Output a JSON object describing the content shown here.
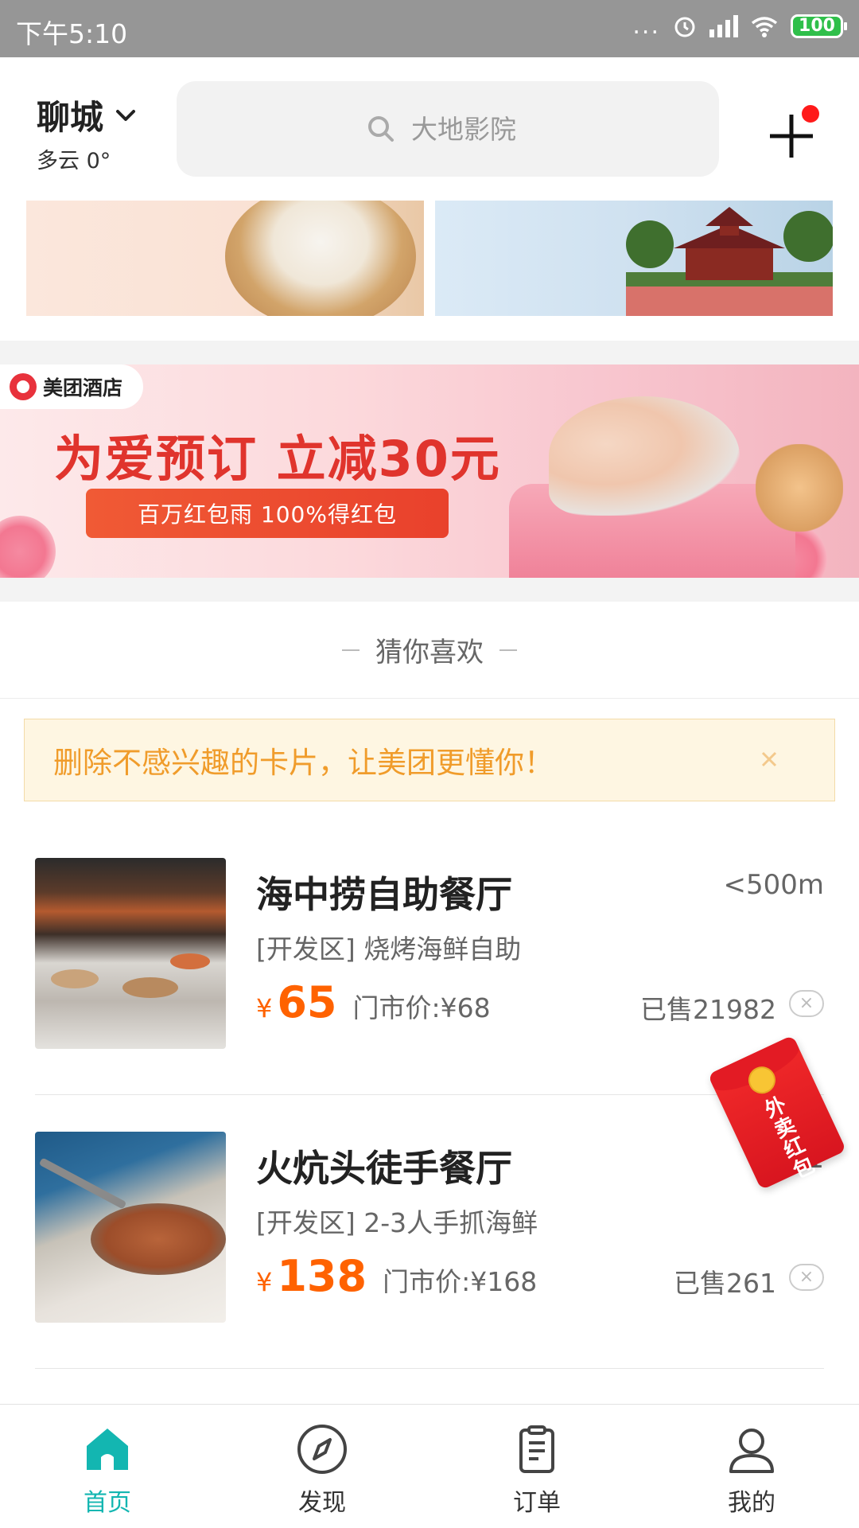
{
  "status_bar": {
    "time": "下午5:10",
    "dots": "...",
    "battery": "100"
  },
  "header": {
    "city": "聊城",
    "weather": "多云 0°",
    "search_placeholder": "大地影院"
  },
  "hotel_banner": {
    "brand": "美团酒店",
    "title": "为爱预订 立减30元",
    "button": "百万红包雨 100%得红包"
  },
  "recommend": {
    "title": "猜你喜欢"
  },
  "notice": {
    "text": "删除不感兴趣的卡片，让美团更懂你！",
    "close": "×"
  },
  "deals": [
    {
      "name": "海中捞自助餐厅",
      "distance": "<500m",
      "subtitle": "[开发区] 烧烤海鲜自助",
      "currency": "¥",
      "price": "65",
      "market_price": "门市价:¥68",
      "sold": "已售21982",
      "dismiss": "×"
    },
    {
      "name": "火炕头徒手餐厅",
      "distance": "1",
      "subtitle": "[开发区] 2-3人手抓海鲜",
      "currency": "¥",
      "price": "138",
      "market_price": "门市价:¥168",
      "sold": "已售261",
      "dismiss": "×"
    }
  ],
  "floating": {
    "envelope_text": "外卖红包"
  },
  "nav": {
    "tabs": [
      {
        "label": "首页",
        "icon": "home-icon",
        "active": true
      },
      {
        "label": "发现",
        "icon": "compass-icon",
        "active": false
      },
      {
        "label": "订单",
        "icon": "order-icon",
        "active": false
      },
      {
        "label": "我的",
        "icon": "user-icon",
        "active": false
      }
    ]
  },
  "colors": {
    "accent": "#13b6b1",
    "price": "#ff6200",
    "notice_text": "#f09c2b",
    "status_bar": "#969696"
  }
}
